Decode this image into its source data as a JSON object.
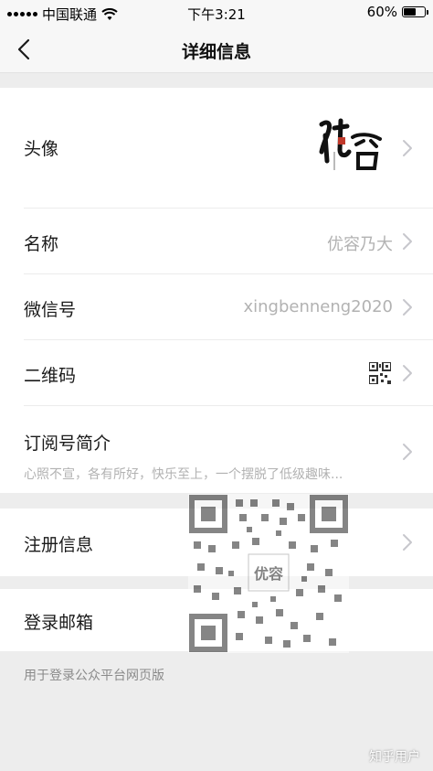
{
  "status_bar": {
    "carrier": "中国联通",
    "time": "下午3:21",
    "battery_percent": "60%",
    "battery_level": 0.6
  },
  "nav": {
    "title": "详细信息"
  },
  "rows": {
    "avatar": {
      "label": "头像",
      "logo_text": "优容"
    },
    "name": {
      "label": "名称",
      "value": "优容乃大"
    },
    "wechat_id": {
      "label": "微信号",
      "value": "xingbenneng2020"
    },
    "qrcode": {
      "label": "二维码"
    },
    "intro": {
      "label": "订阅号简介",
      "value": "心照不宣，各有所好，快乐至上，一个摆脱了低级趣味..."
    },
    "registration": {
      "label": "注册信息"
    },
    "login_email": {
      "label": "登录邮箱"
    }
  },
  "footer_note": "用于登录公众平台网页版",
  "qr_overlay": {
    "center_text": "优容"
  },
  "watermark": "知乎用户",
  "colors": {
    "background": "#ededed",
    "cell": "#ffffff",
    "secondary_text": "#b2b2b2",
    "chevron": "#c7c7cc"
  }
}
